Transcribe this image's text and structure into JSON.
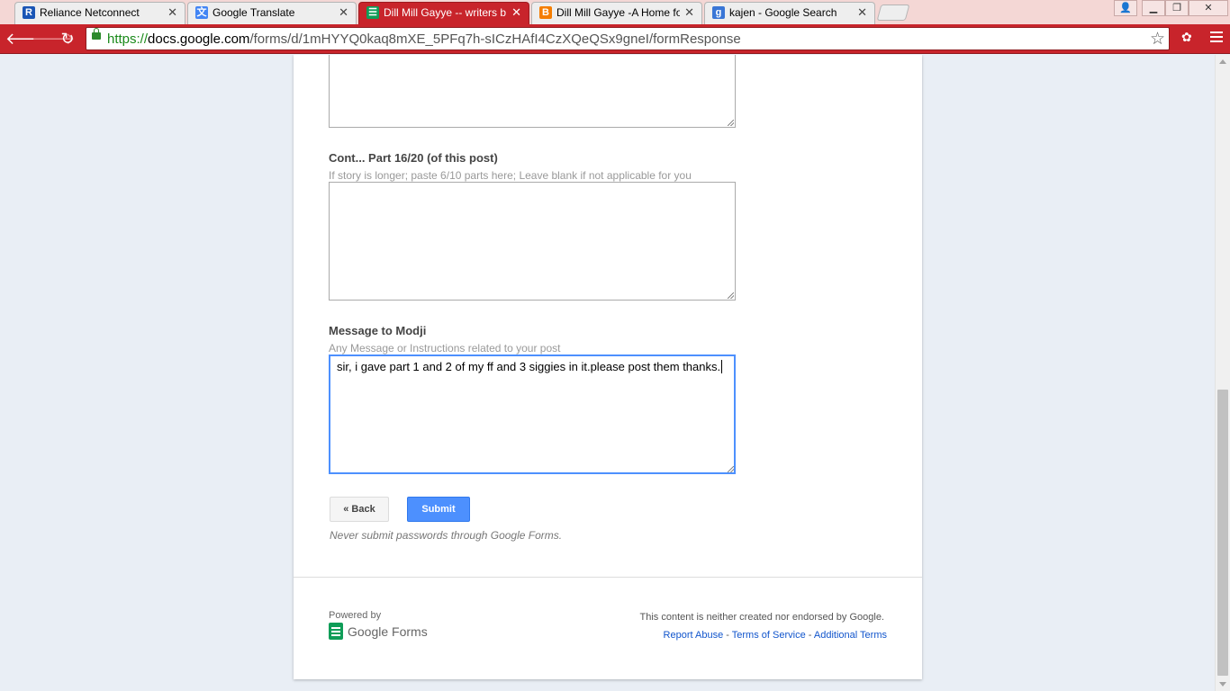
{
  "tabs": [
    {
      "title": "Reliance Netconnect",
      "icon": "reliance-r-icon",
      "icon_char": "R",
      "icon_color": "#1a55b5"
    },
    {
      "title": "Google Translate",
      "icon": "translate-icon",
      "icon_char": "文",
      "icon_color": "#4285f4"
    },
    {
      "title": "Dill Mill Gayye -- writers b",
      "icon": "google-forms-icon",
      "icon_char": "☰",
      "icon_color": "#0f9d58"
    },
    {
      "title": "Dill Mill Gayye -A Home fo",
      "icon": "blogger-icon",
      "icon_char": "B",
      "icon_color": "#f57d00"
    },
    {
      "title": "kajen - Google Search",
      "icon": "google-g-icon",
      "icon_char": "g",
      "icon_color": "#3a76d6"
    }
  ],
  "address_bar": {
    "scheme": "https://",
    "host": "docs.google.com",
    "path": "/forms/d/1mHYYQ0kaq8mXE_5PFq7h-sICzHAfI4CzXQeQSx9gneI/formResponse"
  },
  "form": {
    "q16_title": "Cont... Part 16/20 (of this post)",
    "q16_help": "If story is longer; paste 6/10 parts here; Leave blank if not applicable for you",
    "msg_title": "Message to Modji",
    "msg_help": "Any Message or Instructions related to your post",
    "msg_value": "sir, i gave part 1 and 2 of my ff and 3 siggies in it.please post them thanks.",
    "back_label": "« Back",
    "submit_label": "Submit",
    "warning": "Never submit passwords through Google Forms."
  },
  "footer": {
    "powered_by": "Powered by",
    "brand_google": "Google",
    "brand_forms": "Forms",
    "disclaimer": "This content is neither created nor endorsed by Google.",
    "report_abuse": "Report Abuse",
    "terms": "Terms of Service",
    "additional_terms": "Additional Terms",
    "separator": " - "
  },
  "colors": {
    "browser_theme": "#c8242b",
    "submit_button": "#4d90fe",
    "link": "#1155cc",
    "forms_green": "#0f9d58"
  }
}
